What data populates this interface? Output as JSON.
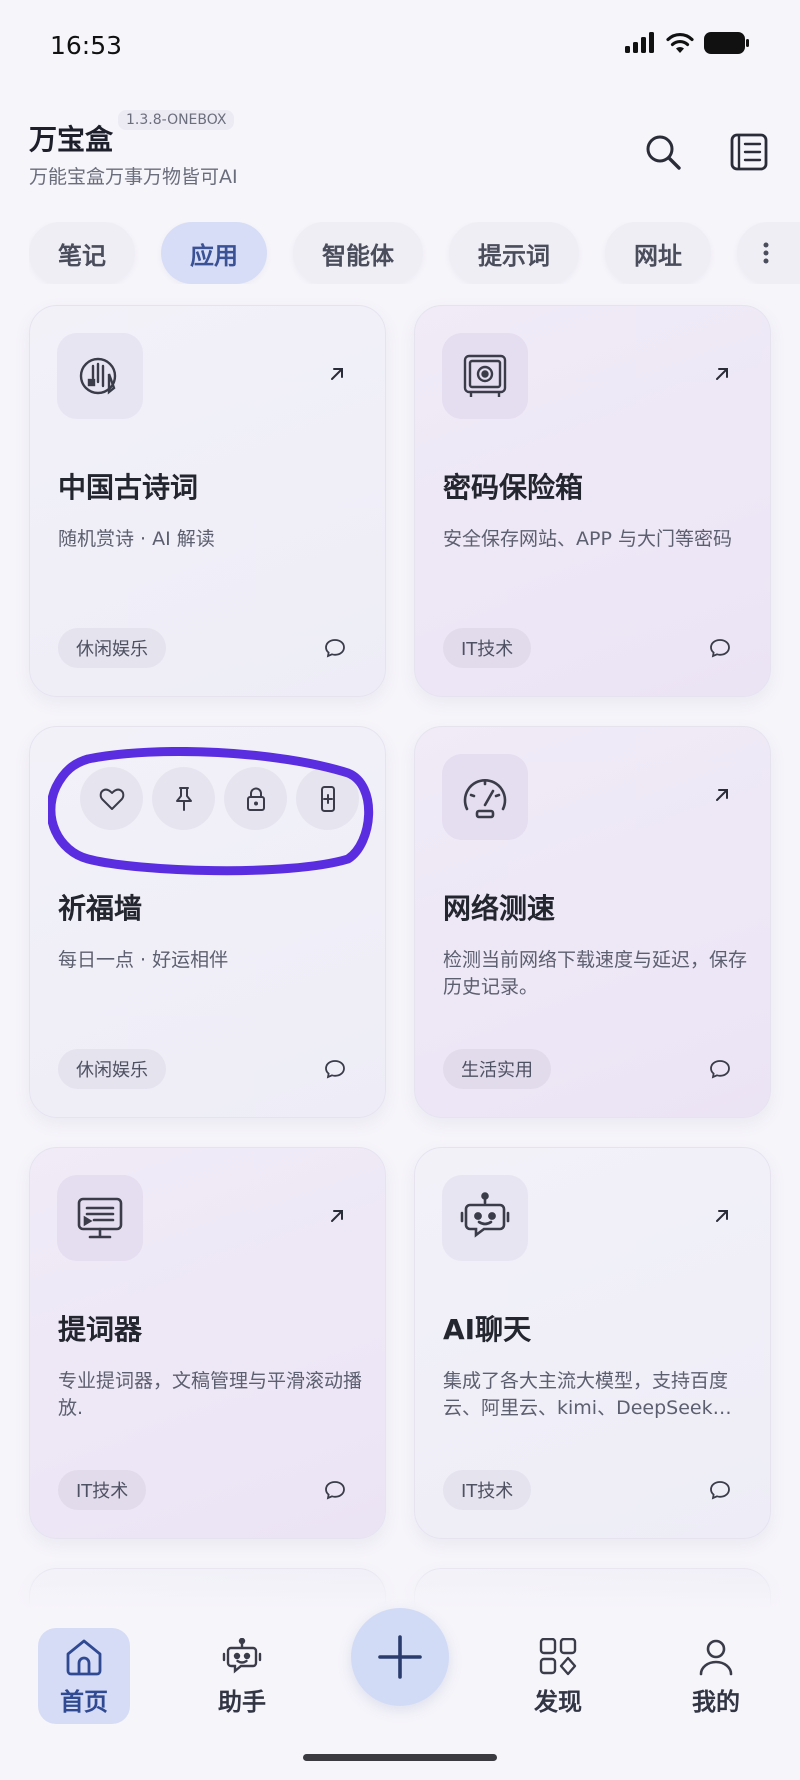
{
  "status_bar": {
    "time": "16:53"
  },
  "header": {
    "title": "万宝盒",
    "version": "1.3.8-ONEBOX",
    "subtitle": "万能宝盒万事万物皆可AI"
  },
  "tabs": [
    {
      "label": "笔记",
      "active": false
    },
    {
      "label": "应用",
      "active": true
    },
    {
      "label": "智能体",
      "active": false
    },
    {
      "label": "提示词",
      "active": false
    },
    {
      "label": "网址",
      "active": false
    }
  ],
  "cards": [
    {
      "title": "中国古诗词",
      "desc": "随机赏诗 · AI 解读",
      "tag": "休闲娱乐",
      "icon": "poetry-icon"
    },
    {
      "title": "密码保险箱",
      "desc": "安全保存网站、APP 与大门等密码",
      "tag": "IT技术",
      "icon": "safe-icon"
    },
    {
      "title": "祈福墙",
      "desc": "每日一点 · 好运相伴",
      "tag": "休闲娱乐",
      "icon": "prayer-icon"
    },
    {
      "title": "网络测速",
      "desc": "检测当前网络下载速度与延迟，保存历史记录。",
      "tag": "生活实用",
      "icon": "speedometer-icon"
    },
    {
      "title": "提词器",
      "desc": "专业提词器，文稿管理与平滑滚动播放.",
      "tag": "IT技术",
      "icon": "teleprompter-icon"
    },
    {
      "title": "AI聊天",
      "desc": "集成了各大主流大模型，支持百度云、阿里云、kimi、DeepSeek等大模型",
      "tag": "IT技术",
      "icon": "robot-icon"
    }
  ],
  "quick_actions": [
    "heart-icon",
    "pin-icon",
    "lock-icon",
    "add-to-home-icon"
  ],
  "bottom_nav": [
    {
      "label": "首页",
      "active": true
    },
    {
      "label": "助手",
      "active": false
    },
    {
      "label": "发现",
      "active": false
    },
    {
      "label": "我的",
      "active": false
    }
  ],
  "colors": {
    "accent": "#3b5196",
    "highlight_ring": "#5a2ee0"
  }
}
